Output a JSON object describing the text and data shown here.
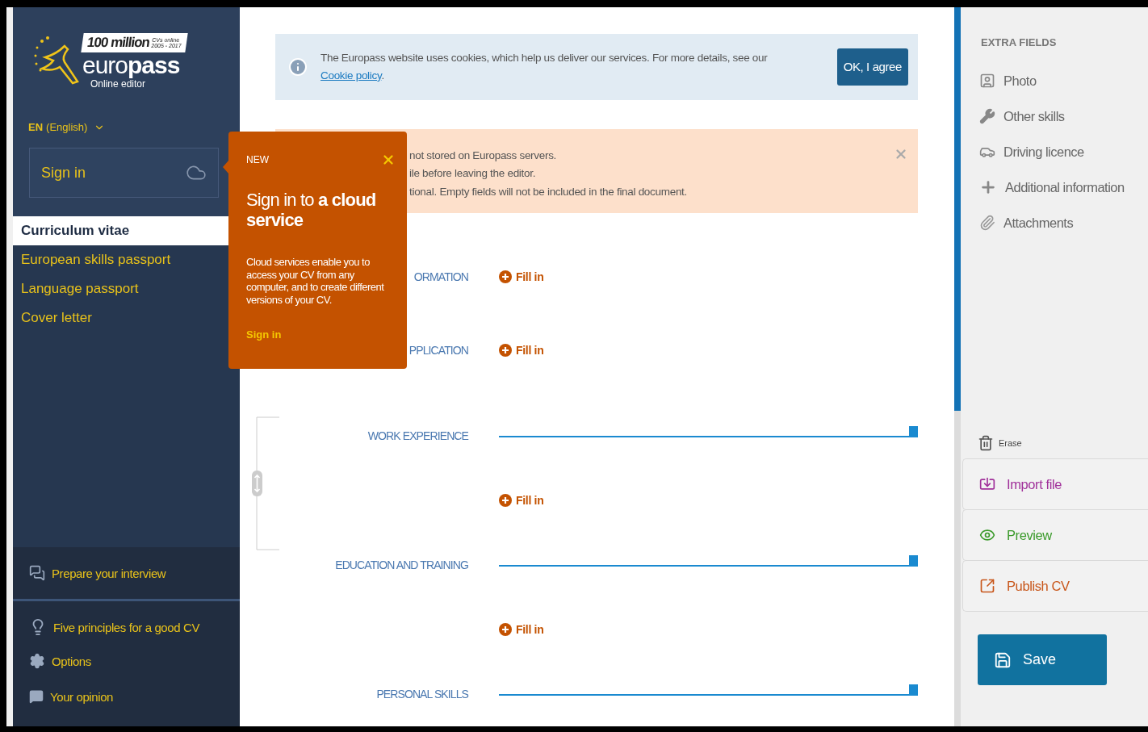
{
  "sidebar": {
    "logo": {
      "badge": "100 million",
      "badge_note": [
        "CVs online",
        "2005 - 2017"
      ],
      "name": "euro**pass**",
      "subtitle": "Online editor"
    },
    "language": {
      "code": "EN",
      "name": "(English)"
    },
    "sign_in": "Sign in",
    "documents": [
      {
        "label": "Curriculum vitae",
        "selected": true
      },
      {
        "label": "European skills passport",
        "selected": false
      },
      {
        "label": "Language passport",
        "selected": false
      },
      {
        "label": "Cover letter",
        "selected": false
      }
    ],
    "interview": "Prepare your interview",
    "links": [
      {
        "label": "Five principles for a good CV",
        "kind": "tips"
      },
      {
        "label": "Options",
        "kind": "options"
      },
      {
        "label": "Your opinion",
        "kind": "opinion"
      }
    ]
  },
  "cookie_banner": {
    "text": "The Europass website uses cookies, which help us deliver our services. For more details, see our ",
    "link": "Cookie policy",
    "end": ".",
    "button": "OK, I agree"
  },
  "notice": {
    "lines": [
      "not stored on Europass servers.",
      "ile before leaving the editor.",
      "tional. Empty fields will not be included in the final document."
    ]
  },
  "sections": [
    {
      "title": "ORMATION",
      "kind": "inline",
      "action": "Fill in"
    },
    {
      "title": "PPLICATION",
      "kind": "inline",
      "action": "Fill in"
    },
    {
      "title": "WORK EXPERIENCE",
      "kind": "block",
      "action": "Fill in"
    },
    {
      "title": "EDUCATION AND TRAINING",
      "kind": "block",
      "action": "Fill in"
    },
    {
      "title": "PERSONAL SKILLS",
      "kind": "block"
    }
  ],
  "extra_fields": {
    "title": "EXTRA FIELDS",
    "items": [
      {
        "label": "Photo",
        "kind": "photo"
      },
      {
        "label": "Other skills",
        "kind": "skills"
      },
      {
        "label": "Driving licence",
        "kind": "driving"
      },
      {
        "label": "Additional information",
        "kind": "additional"
      },
      {
        "label": "Attachments",
        "kind": "attachments"
      }
    ]
  },
  "erase": "Erase",
  "actions": [
    {
      "label": "Import file",
      "kind": "import"
    },
    {
      "label": "Preview",
      "kind": "preview"
    },
    {
      "label": "Publish CV",
      "kind": "publish"
    }
  ],
  "save": "Save",
  "popup": {
    "tag": "NEW",
    "title": "Sign in to **a cloud service**",
    "text": "Cloud services enable you to access your CV from any computer, and to create different versions of your CV.",
    "link": "Sign in"
  }
}
